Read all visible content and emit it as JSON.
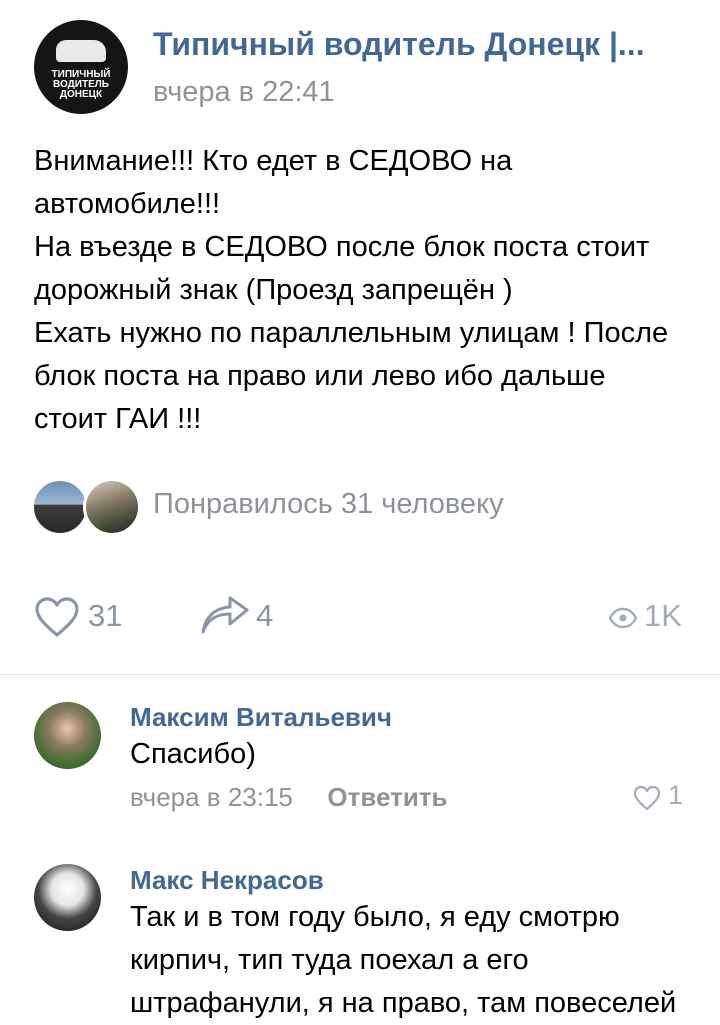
{
  "post": {
    "group_name": "Типичный водитель Донецк |...",
    "time": "вчера в 22:41",
    "avatar_logo_line1": "ТИПИЧНЫЙ",
    "avatar_logo_line2": "ВОДИТЕЛЬ",
    "avatar_logo_line3": "ДОНЕЦК",
    "text": "Внимание!!! Кто едет в СЕДОВО на\nавтомобиле!!!\nНа въезде в СЕДОВО после блок поста стоит\nдорожный знак (Проезд запрещён )\nЕхать нужно по параллельным улицам ! После\nблок поста на право или лево ибо дальше\nстоит ГАИ !!!",
    "likes_summary": "Понравилось 31 человеку",
    "like_count": "31",
    "share_count": "4",
    "views_count": "1K"
  },
  "comments": [
    {
      "author": "Максим Витальевич",
      "text": "Спасибо)",
      "time": "вчера в 23:15",
      "reply_label": "Ответить",
      "like_count": "1"
    },
    {
      "author": "Макс Некрасов",
      "text": "Так и в том году было, я еду смотрю\nкирпич, тип туда поехал а его\nштрафанули, я на право, там повеселей"
    }
  ],
  "colors": {
    "accent": "#426894",
    "secondary_text": "#8e9399",
    "icon": "#8a96a8"
  },
  "icons": {
    "like": "heart-icon",
    "share": "share-arrow-icon",
    "views": "eye-icon"
  }
}
